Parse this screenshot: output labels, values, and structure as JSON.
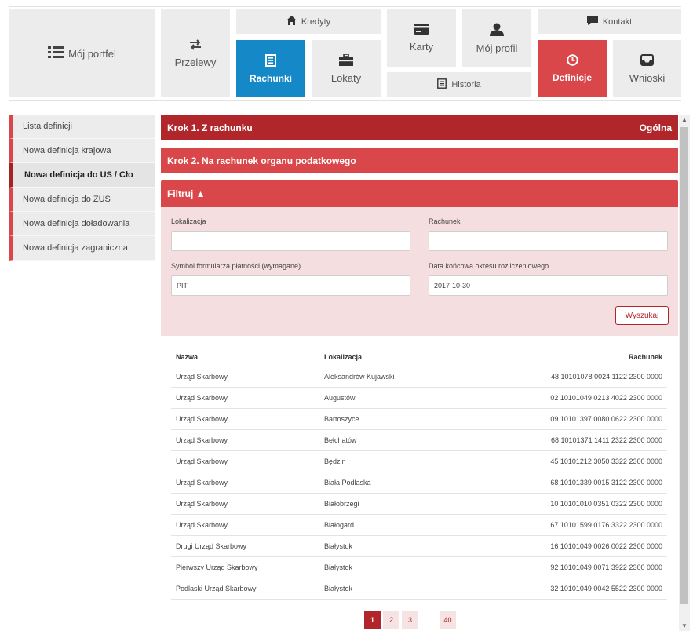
{
  "top_note": "(…) (…)",
  "nav": {
    "portfolio": "Mój portfel",
    "transfers": "Przelewy",
    "credits": "Kredyty",
    "accounts": "Rachunki",
    "deposits": "Lokaty",
    "cards": "Karty",
    "profile": "Mój profil",
    "history": "Historia",
    "contact": "Kontakt",
    "definitions": "Definicje",
    "applications": "Wnioski"
  },
  "sidebar": {
    "items": [
      {
        "label": "Lista definicji"
      },
      {
        "label": "Nowa definicja krajowa"
      },
      {
        "label": "Nowa definicja do US / Cło"
      },
      {
        "label": "Nowa definicja do ZUS"
      },
      {
        "label": "Nowa definicja doładowania"
      },
      {
        "label": "Nowa definicja zagraniczna"
      }
    ]
  },
  "steps": {
    "step1": "Krok 1. Z rachunku",
    "step1_right": "Ogólna",
    "step2": "Krok 2. Na rachunek organu podatkowego"
  },
  "filter": {
    "title": "Filtruj ▲",
    "location_label": "Lokalizacja",
    "location_value": "",
    "account_label": "Rachunek",
    "account_value": "",
    "symbol_label": "Symbol formularza płatności (wymagane)",
    "symbol_value": "PIT",
    "date_label": "Data końcowa okresu rozliczeniowego",
    "date_value": "2017-10-30",
    "search_button": "Wyszukaj"
  },
  "table": {
    "headers": [
      "Nazwa",
      "Lokalizacja",
      "Rachunek"
    ],
    "rows": [
      [
        "Urząd Skarbowy",
        "Aleksandrów Kujawski",
        "48 10101078 0024 1122 2300 0000"
      ],
      [
        "Urząd Skarbowy",
        "Augustów",
        "02 10101049 0213 4022 2300 0000"
      ],
      [
        "Urząd Skarbowy",
        "Bartoszyce",
        "09 10101397 0080 0622 2300 0000"
      ],
      [
        "Urząd Skarbowy",
        "Bełchatów",
        "68 10101371 1411 2322 2300 0000"
      ],
      [
        "Urząd Skarbowy",
        "Będzin",
        "45 10101212 3050 3322 2300 0000"
      ],
      [
        "Urząd Skarbowy",
        "Biała Podlaska",
        "68 10101339 0015 3122 2300 0000"
      ],
      [
        "Urząd Skarbowy",
        "Białobrzegi",
        "10 10101010 0351 0322 2300 0000"
      ],
      [
        "Urząd Skarbowy",
        "Białogard",
        "67 10101599 0176 3322 2300 0000"
      ],
      [
        "Drugi Urząd Skarbowy",
        "Białystok",
        "16 10101049 0026 0022 2300 0000"
      ],
      [
        "Pierwszy Urząd Skarbowy",
        "Białystok",
        "92 10101049 0071 3922 2300 0000"
      ],
      [
        "Podlaski Urząd Skarbowy",
        "Białystok",
        "32 10101049 0042 5522 2300 0000"
      ]
    ]
  },
  "pagination": {
    "pages": [
      "1",
      "2",
      "3",
      "…",
      "40"
    ],
    "current": "1"
  },
  "colors": {
    "brand_red": "#d9474a",
    "dark_red": "#b0262b",
    "blue": "#1589c7",
    "tile_gray": "#ececec",
    "filter_bg": "#f5dedf"
  },
  "icons": {
    "portfolio": "list-icon",
    "transfers": "arrows-exchange-icon",
    "credits": "home-icon",
    "accounts": "document-list-icon",
    "deposits": "briefcase-icon",
    "cards": "credit-card-icon",
    "profile": "user-icon",
    "history": "history-list-icon",
    "contact": "chat-icon",
    "definitions": "clock-icon",
    "applications": "inbox-icon"
  }
}
